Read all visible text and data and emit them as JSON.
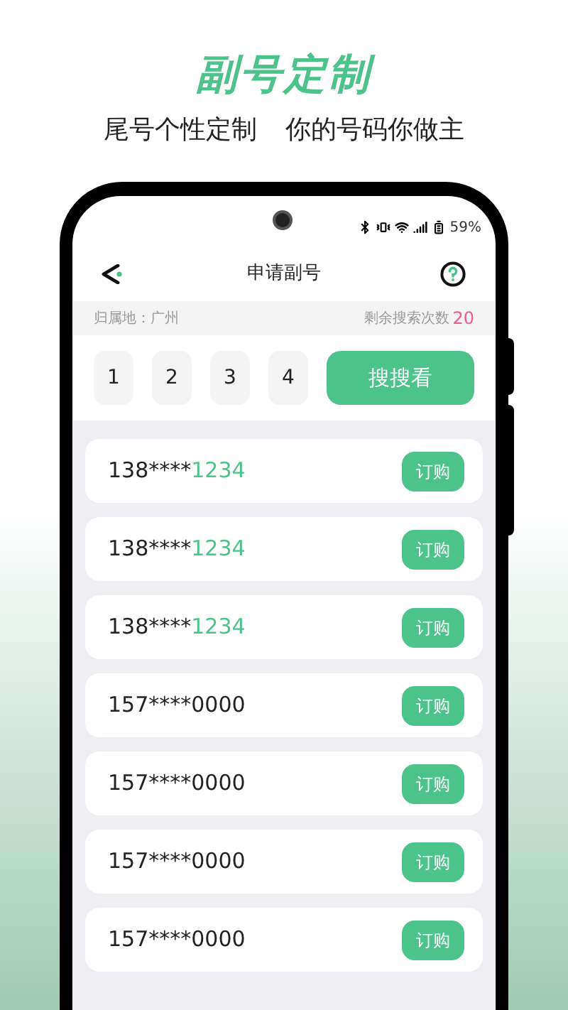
{
  "promo": {
    "title": "副号定制",
    "subtitle_left": "尾号个性定制",
    "subtitle_right": "你的号码你做主"
  },
  "status_bar": {
    "battery": "59%"
  },
  "header": {
    "title": "申请副号"
  },
  "info_bar": {
    "location_label": "归属地：广州",
    "remaining_label": "剩余搜索次数",
    "remaining_count": "20"
  },
  "digits": [
    "1",
    "2",
    "3",
    "4"
  ],
  "search_button": "搜搜看",
  "numbers": [
    {
      "prefix": "138****",
      "suffix": "1234",
      "highlighted": true,
      "action": "订购"
    },
    {
      "prefix": "138****",
      "suffix": "1234",
      "highlighted": true,
      "action": "订购"
    },
    {
      "prefix": "138****",
      "suffix": "1234",
      "highlighted": true,
      "action": "订购"
    },
    {
      "prefix": "157****",
      "suffix": "0000",
      "highlighted": false,
      "action": "订购"
    },
    {
      "prefix": "157****",
      "suffix": "0000",
      "highlighted": false,
      "action": "订购"
    },
    {
      "prefix": "157****",
      "suffix": "0000",
      "highlighted": false,
      "action": "订购"
    },
    {
      "prefix": "157****",
      "suffix": "0000",
      "highlighted": false,
      "action": "订购"
    }
  ]
}
